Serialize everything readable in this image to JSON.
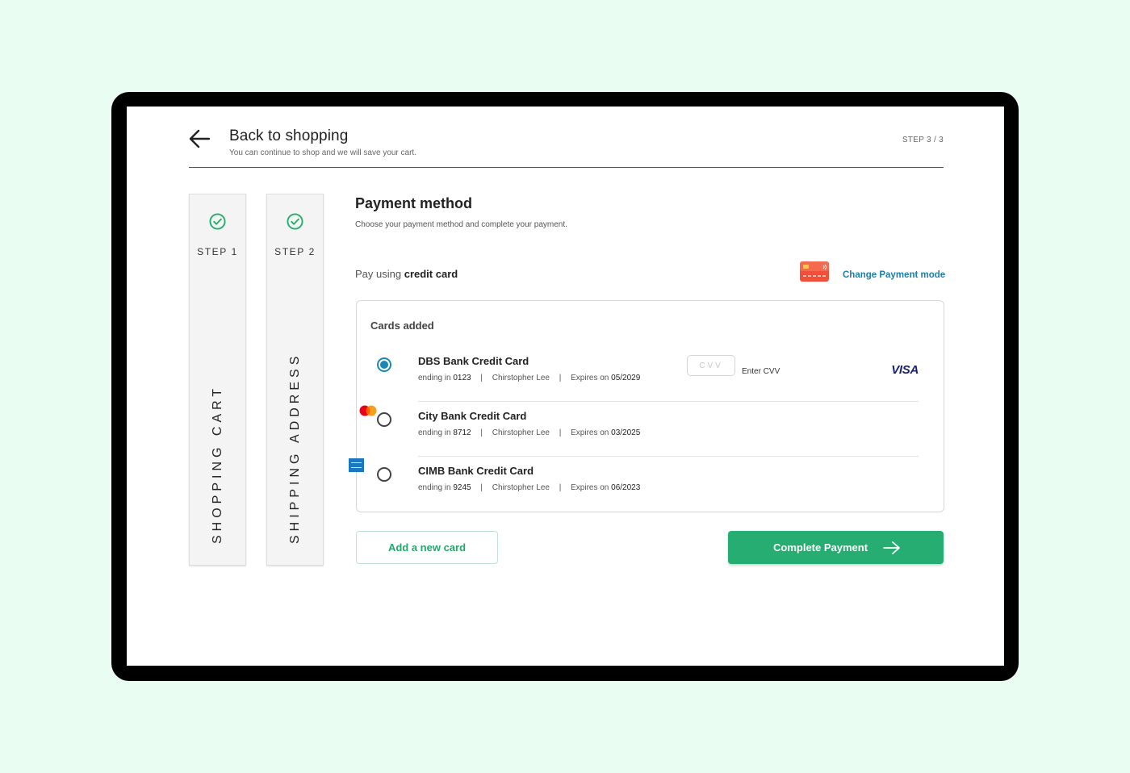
{
  "header": {
    "back_title": "Back to shopping",
    "back_subtitle": "You can continue to shop and we will save your cart.",
    "step_count": "STEP 3 / 3"
  },
  "steps": [
    {
      "label": "STEP 1",
      "title": "SHOPPING CART",
      "status": "complete"
    },
    {
      "label": "STEP 2",
      "title": "SHIPPING ADDRESS",
      "status": "complete"
    }
  ],
  "payment": {
    "title": "Payment method",
    "subtitle": "Choose your payment method and complete your payment.",
    "pay_using_prefix": "Pay using",
    "pay_using_method": "credit card",
    "change_link": "Change Payment mode"
  },
  "cards_section": {
    "title": "Cards added",
    "cards": [
      {
        "name": "DBS Bank Credit Card",
        "ending_label": "ending in",
        "ending": "0123",
        "holder": "Chirstopher Lee",
        "expires_label": "Expires on",
        "expires": "05/2029",
        "brand": "visa",
        "brand_text": "VISA",
        "selected": true
      },
      {
        "name": "City Bank Credit Card",
        "ending_label": "ending in",
        "ending": "8712",
        "holder": "Chirstopher Lee",
        "expires_label": "Expires on",
        "expires": "03/2025",
        "brand": "mastercard",
        "selected": false
      },
      {
        "name": "CIMB Bank Credit Card",
        "ending_label": "ending in",
        "ending": "9245",
        "holder": "Chirstopher Lee",
        "expires_label": "Expires on",
        "expires": "06/2023",
        "brand": "amex",
        "selected": false
      }
    ],
    "cvv_placeholder": "CVV",
    "cvv_value": "",
    "enter_cvv_label": "Enter CVV"
  },
  "actions": {
    "add_card": "Add a new card",
    "complete_payment": "Complete Payment"
  },
  "colors": {
    "background": "#e9fdf3",
    "accent_green": "#25ad72",
    "link_blue": "#1b7fad",
    "radio_blue": "#1b87b5"
  }
}
